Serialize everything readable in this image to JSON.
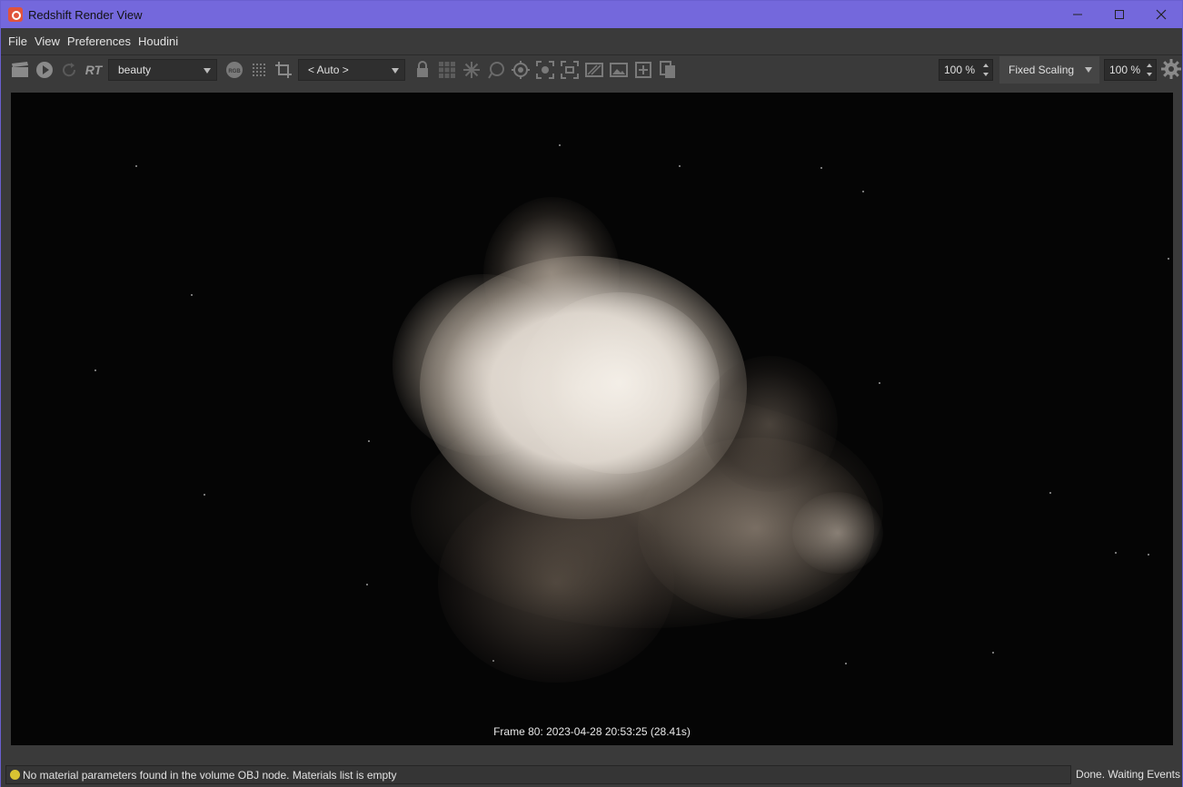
{
  "window": {
    "title": "Redshift Render View",
    "controls": {
      "minimize": "—",
      "maximize": "☐",
      "close": "✕"
    }
  },
  "menubar": {
    "items": [
      {
        "label": "File"
      },
      {
        "label": "View"
      },
      {
        "label": "Preferences"
      },
      {
        "label": "Houdini"
      }
    ]
  },
  "toolbar": {
    "rt_label": "RT",
    "aov_value": "beauty",
    "rgb_label": "RGB",
    "camera_value": "< Auto >",
    "zoom_value": "100 %",
    "scaling_mode": "Fixed Scaling",
    "scaling_value": "100 %"
  },
  "viewport": {
    "frame_info": "Frame  80:  2023-04-28  20:53:25  (28.41s)"
  },
  "status": {
    "message": "No material parameters found in the volume OBJ node. Materials list is empty",
    "state": "Done. Waiting Events",
    "indicator_color": "#d8c232"
  },
  "colors": {
    "titlebar": "#7468dc",
    "background": "#3a3a3a",
    "viewport": "#050505",
    "cloud": "#e8e1d8"
  }
}
